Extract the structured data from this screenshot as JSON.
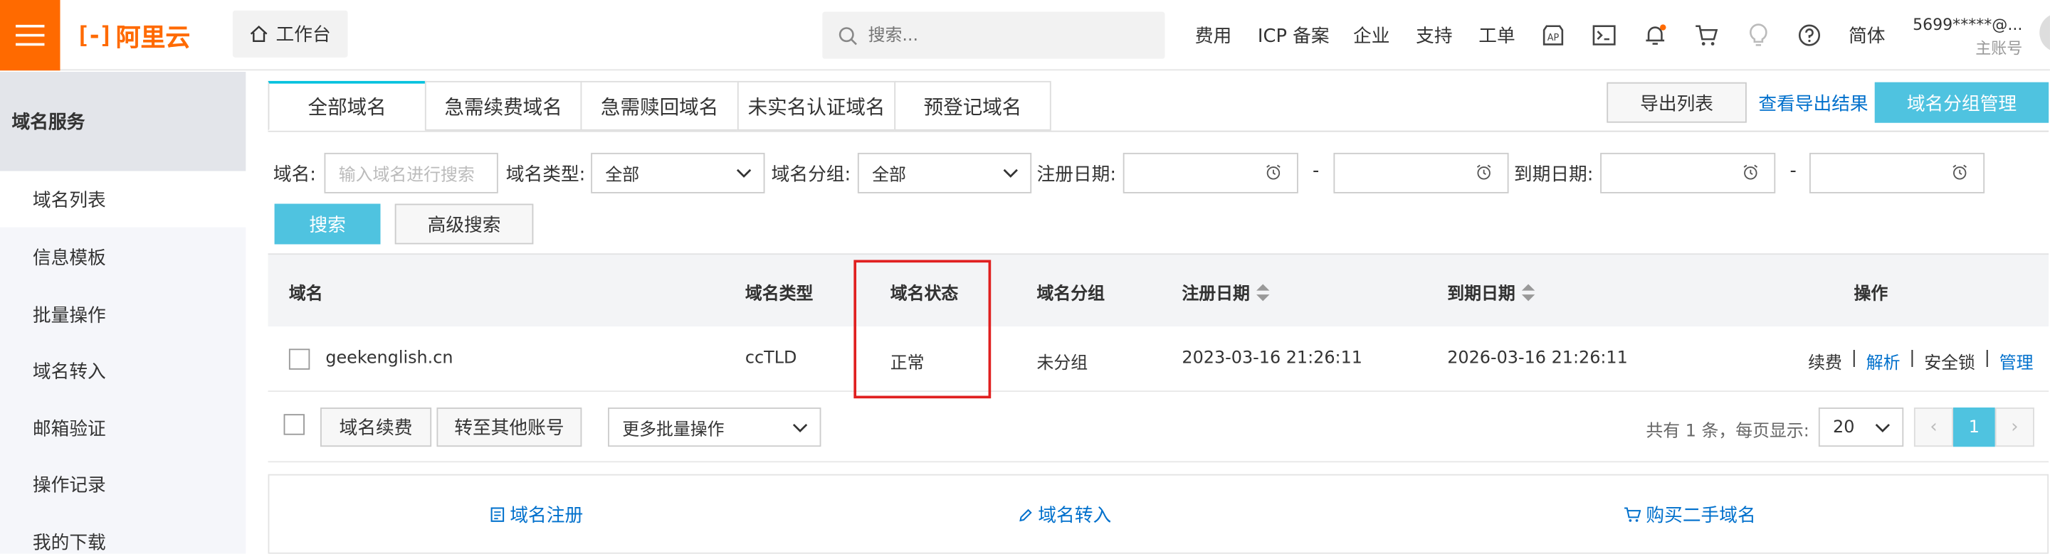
{
  "topbar": {
    "logo_text": "阿里云",
    "workbench_label": "工作台",
    "search_placeholder": "搜索...",
    "nav": [
      "费用",
      "ICP 备案",
      "企业",
      "支持",
      "工单"
    ],
    "lang": "简体",
    "account_name": "5699*****@...",
    "account_type": "主账号"
  },
  "sidebar": {
    "title": "域名服务",
    "items": [
      "域名列表",
      "信息模板",
      "批量操作",
      "域名转入",
      "邮箱验证",
      "操作记录",
      "我的下载"
    ]
  },
  "tabs": [
    "全部域名",
    "急需续费域名",
    "急需赎回域名",
    "未实名认证域名",
    "预登记域名"
  ],
  "actions": {
    "export_list": "导出列表",
    "view_export": "查看导出结果",
    "group_manage": "域名分组管理"
  },
  "filters": {
    "domain_label": "域名:",
    "domain_placeholder": "输入域名进行搜索",
    "type_label": "域名类型:",
    "type_value": "全部",
    "group_label": "域名分组:",
    "group_value": "全部",
    "reg_date_label": "注册日期:",
    "exp_date_label": "到期日期:",
    "dash": "-",
    "search_btn": "搜索",
    "advanced_btn": "高级搜索"
  },
  "table": {
    "headers": [
      "域名",
      "域名类型",
      "域名状态",
      "域名分组",
      "注册日期",
      "到期日期",
      "操作"
    ],
    "rows": [
      {
        "domain": "geekenglish.cn",
        "type": "ccTLD",
        "status": "正常",
        "group": "未分组",
        "reg_date": "2023-03-16 21:26:11",
        "exp_date": "2026-03-16 21:26:11",
        "ops": [
          "续费",
          "解析",
          "安全锁",
          "管理"
        ]
      }
    ]
  },
  "bulk": {
    "renew_btn": "域名续费",
    "transfer_btn": "转至其他账号",
    "more_ops": "更多批量操作",
    "total_text": "共有 1 条，每页显示:",
    "page_size": "20",
    "current_page": "1",
    "prev": "‹",
    "next": "›"
  },
  "quick_links": [
    "域名注册",
    "域名转入",
    "购买二手域名"
  ],
  "colors": {
    "brand": "#ff6a00",
    "accent": "#4fc3e0",
    "link": "#0070cc",
    "highlight": "#e02020"
  }
}
